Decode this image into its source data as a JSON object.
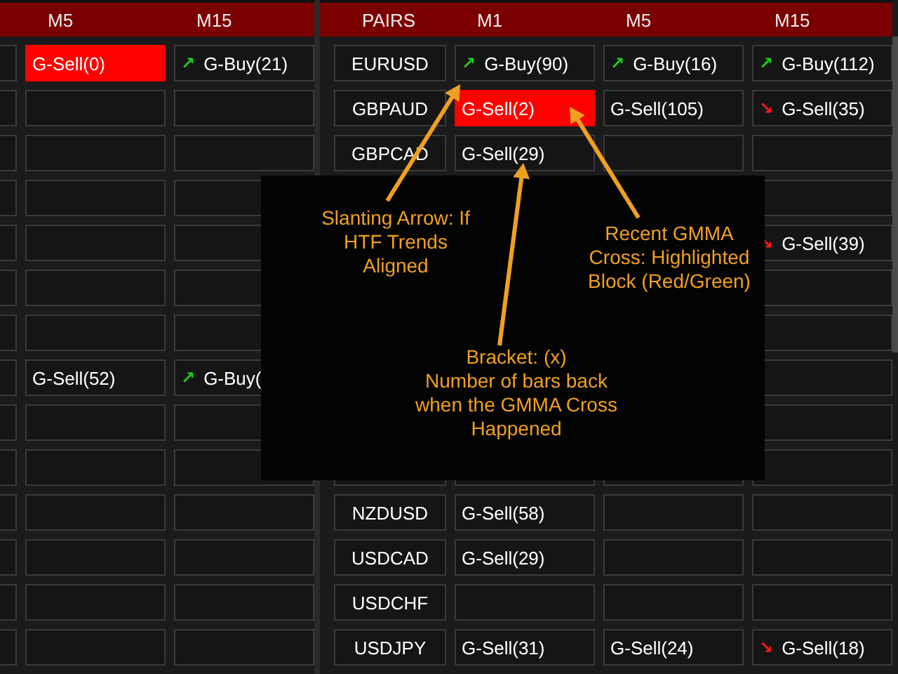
{
  "left_table": {
    "columns": [
      "M5",
      "M15"
    ],
    "rows": [
      {
        "cells": [
          {
            "text": "G-Sell(0)",
            "highlighted": true
          },
          {
            "text": "G-Buy(21)",
            "arrow": "↗",
            "highlighted": false
          }
        ]
      },
      {
        "cells": [
          {
            "highlighted": false
          },
          {
            "highlighted": false
          }
        ]
      },
      {
        "cells": [
          {
            "highlighted": false
          },
          {
            "highlighted": false
          }
        ]
      },
      {
        "cells": [
          {
            "highlighted": false
          },
          {
            "highlighted": false
          }
        ]
      },
      {
        "cells": [
          {
            "highlighted": false
          },
          {
            "highlighted": false
          }
        ]
      },
      {
        "cells": [
          {
            "highlighted": false
          },
          {
            "highlighted": false
          }
        ]
      },
      {
        "cells": [
          {
            "highlighted": false
          },
          {
            "highlighted": false
          }
        ]
      },
      {
        "cells": [
          {
            "text": "G-Sell(52)",
            "highlighted": false
          },
          {
            "text": "G-Buy(",
            "arrow": "↗",
            "highlighted": false
          }
        ]
      },
      {
        "cells": [
          {
            "highlighted": false
          },
          {
            "highlighted": false
          }
        ]
      },
      {
        "cells": [
          {
            "highlighted": false
          },
          {
            "highlighted": false
          }
        ]
      },
      {
        "cells": [
          {
            "highlighted": false
          },
          {
            "highlighted": false
          }
        ]
      },
      {
        "cells": [
          {
            "highlighted": false
          },
          {
            "highlighted": false
          }
        ]
      },
      {
        "cells": [
          {
            "highlighted": false
          },
          {
            "highlighted": false
          }
        ]
      },
      {
        "cells": [
          {
            "highlighted": false
          },
          {
            "highlighted": false
          }
        ]
      }
    ]
  },
  "right_table": {
    "columns": [
      "PAIRS",
      "M1",
      "M5",
      "M15"
    ],
    "rows": [
      {
        "cells": [
          {
            "kind": "pair",
            "text": "EURUSD"
          },
          {
            "text": "G-Buy(90)",
            "arrow": "↗",
            "highlighted": false
          },
          {
            "text": "G-Buy(16)",
            "arrow": "↗",
            "highlighted": false
          },
          {
            "text": "G-Buy(112)",
            "arrow": "↗",
            "highlighted": false
          }
        ]
      },
      {
        "cells": [
          {
            "kind": "pair",
            "text": "GBPAUD"
          },
          {
            "text": "G-Sell(2)",
            "highlighted": true
          },
          {
            "text": "G-Sell(105)",
            "highlighted": false
          },
          {
            "text": "G-Sell(35)",
            "arrow": "↘",
            "highlighted": false
          }
        ]
      },
      {
        "cells": [
          {
            "kind": "pair",
            "text": "GBPCAD"
          },
          {
            "text": "G-Sell(29)",
            "highlighted": false
          },
          {
            "highlighted": false
          },
          {
            "highlighted": false
          }
        ]
      },
      {
        "cells": [
          {
            "kind": "pair"
          },
          {},
          {},
          {
            "highlighted": false
          }
        ]
      },
      {
        "cells": [
          {
            "kind": "pair"
          },
          {},
          {},
          {
            "text": "G-Sell(39)",
            "arrow": "↘",
            "highlighted": false
          }
        ]
      },
      {
        "cells": [
          {
            "kind": "pair"
          },
          {},
          {},
          {
            "highlighted": false
          }
        ]
      },
      {
        "cells": [
          {
            "kind": "pair"
          },
          {},
          {},
          {
            "highlighted": false
          }
        ]
      },
      {
        "cells": [
          {
            "kind": "pair"
          },
          {},
          {},
          {
            "highlighted": false
          }
        ]
      },
      {
        "cells": [
          {
            "kind": "pair"
          },
          {},
          {},
          {
            "highlighted": false
          }
        ]
      },
      {
        "cells": [
          {
            "kind": "pair"
          },
          {},
          {},
          {
            "highlighted": false
          }
        ]
      },
      {
        "cells": [
          {
            "kind": "pair",
            "text": "NZDUSD"
          },
          {
            "text": "G-Sell(58)",
            "highlighted": false
          },
          {
            "highlighted": false
          },
          {
            "highlighted": false
          }
        ]
      },
      {
        "cells": [
          {
            "kind": "pair",
            "text": "USDCAD"
          },
          {
            "text": "G-Sell(29)",
            "highlighted": false
          },
          {
            "highlighted": false
          },
          {
            "highlighted": false
          }
        ]
      },
      {
        "cells": [
          {
            "kind": "pair",
            "text": "USDCHF"
          },
          {
            "highlighted": false
          },
          {
            "highlighted": false
          },
          {
            "highlighted": false
          }
        ]
      },
      {
        "cells": [
          {
            "kind": "pair",
            "text": "USDJPY"
          },
          {
            "text": "G-Sell(31)",
            "highlighted": false
          },
          {
            "text": "G-Sell(24)",
            "highlighted": false
          },
          {
            "text": "G-Sell(18)",
            "arrow": "↘",
            "highlighted": false
          }
        ]
      }
    ]
  },
  "annotations": [
    {
      "lines": [
        "Slanting Arrow: If",
        "HTF Trends",
        "Aligned"
      ]
    },
    {
      "lines": [
        "Recent GMMA",
        "Cross: Highlighted",
        "Block (Red/Green)"
      ]
    },
    {
      "lines": [
        "Bracket: (x)",
        "Number of bars back",
        "when the GMMA Cross",
        "Happened"
      ]
    }
  ]
}
